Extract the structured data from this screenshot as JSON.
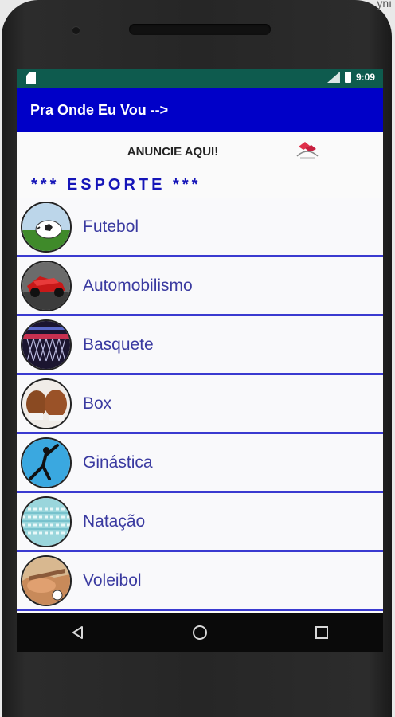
{
  "device": {
    "corner_text": "ynı"
  },
  "status_bar": {
    "time": "9:09"
  },
  "app_bar": {
    "title": "Pra Onde Eu Vou -->"
  },
  "ad": {
    "text": "ANUNCIE AQUI!"
  },
  "section": {
    "title": "*** ESPORTE ***"
  },
  "colors": {
    "app_bar": "#0000c8",
    "status_bar": "#0e5b4e",
    "divider": "#3a3ad0",
    "item_text": "#3a3aa0",
    "section_text": "#1515b8"
  },
  "items": [
    {
      "label": "Futebol",
      "icon": "soccer-ball-icon"
    },
    {
      "label": "Automobilismo",
      "icon": "race-car-icon"
    },
    {
      "label": "Basquete",
      "icon": "basketball-hoop-icon"
    },
    {
      "label": "Box",
      "icon": "boxing-gloves-icon"
    },
    {
      "label": "Ginástica",
      "icon": "gymnast-icon"
    },
    {
      "label": "Natação",
      "icon": "swimming-pool-icon"
    },
    {
      "label": "Voleibol",
      "icon": "volleyball-icon"
    }
  ],
  "nav": [
    "back-icon",
    "home-icon",
    "recents-icon"
  ]
}
